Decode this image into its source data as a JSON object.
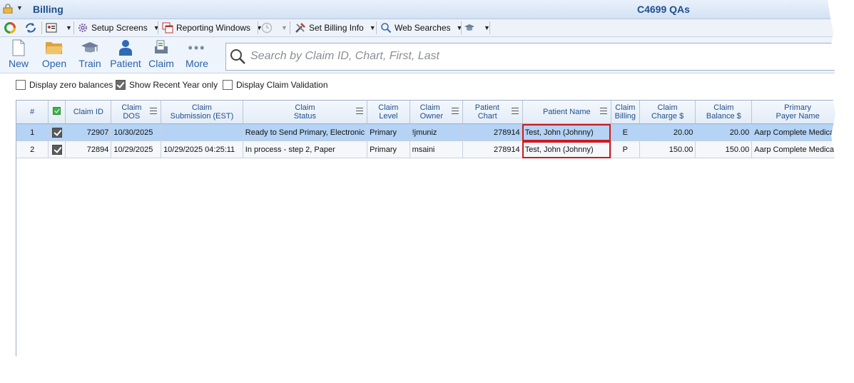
{
  "window": {
    "title": "Billing",
    "context": "C4699 QAs"
  },
  "toolbar": {
    "setup_screens": "Setup Screens",
    "reporting_windows": "Reporting Windows",
    "set_billing_info": "Set Billing Info",
    "web_searches": "Web Searches"
  },
  "ribbon": {
    "new": "New",
    "open": "Open",
    "train": "Train",
    "patient": "Patient",
    "claim": "Claim",
    "more": "More"
  },
  "search": {
    "placeholder": "Search by Claim ID, Chart, First, Last",
    "value": ""
  },
  "options": {
    "zero_balances": {
      "label": "Display zero balances",
      "checked": false
    },
    "recent_year": {
      "label": "Show Recent Year only",
      "checked": true
    },
    "claim_validation": {
      "label": "Display Claim Validation",
      "checked": false
    }
  },
  "grid": {
    "headers": {
      "num": "#",
      "claim_id": "Claim ID",
      "claim_dos_1": "Claim",
      "claim_dos_2": "DOS",
      "submission_1": "Claim",
      "submission_2": "Submission (EST)",
      "status_1": "Claim",
      "status_2": "Status",
      "level_1": "Claim",
      "level_2": "Level",
      "owner_1": "Claim",
      "owner_2": "Owner",
      "chart_1": "Patient",
      "chart_2": "Chart",
      "patient_name": "Patient Name",
      "billing_1": "Claim",
      "billing_2": "Billing",
      "charge_1": "Claim",
      "charge_2": "Charge $",
      "balance_1": "Claim",
      "balance_2": "Balance $",
      "payer_1": "Primary",
      "payer_2": "Payer Name"
    },
    "rows": [
      {
        "num": "1",
        "checked": true,
        "claim_id": "72907",
        "dos": "10/30/2025",
        "submission": "",
        "status": "Ready to Send Primary, Electronic",
        "level": "Primary",
        "owner": "!jmuniz",
        "chart": "278914",
        "patient": "Test, John (Johnny)",
        "billing": "E",
        "charge": "20.00",
        "balance": "20.00",
        "payer": "Aarp Complete Medicare"
      },
      {
        "num": "2",
        "checked": true,
        "claim_id": "72894",
        "dos": "10/29/2025",
        "submission": "10/29/2025 04:25:11",
        "status": "In process - step 2, Paper",
        "level": "Primary",
        "owner": "msaini",
        "chart": "278914",
        "patient": "Test, John (Johnny)",
        "billing": "P",
        "charge": "150.00",
        "balance": "150.00",
        "payer": "Aarp Complete Medicare"
      }
    ]
  },
  "colors": {
    "accent": "#1f4f8b",
    "selected_row": "#b4d3f5",
    "highlight": "#d0191f"
  }
}
